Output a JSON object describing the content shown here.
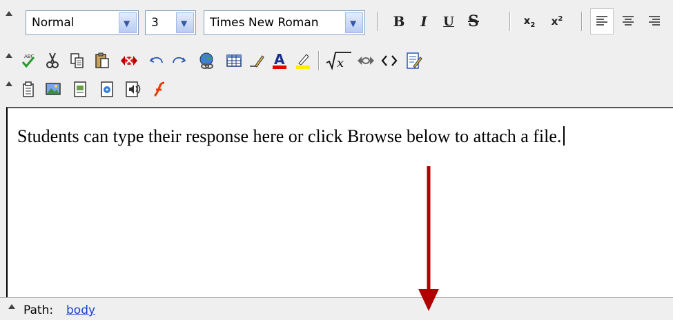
{
  "toolbar": {
    "format_select": {
      "value": "Normal"
    },
    "size_select": {
      "value": "3"
    },
    "font_select": {
      "value": "Times New Roman"
    },
    "bold_label": "B",
    "italic_label": "I",
    "underline_label": "U",
    "strikethrough_label": "S",
    "subscript_label": "x",
    "superscript_label": "x",
    "subscript_mark": "2",
    "superscript_mark": "2"
  },
  "colors": {
    "select_border": "#7f9db9",
    "text_color_bar": "#e00000",
    "highlight_bar": "#ffee00",
    "flash_icon": "#e63a00",
    "arrow": "#b00000",
    "link": "#1a3fd6"
  },
  "editor": {
    "content_text": "Students can type their response here or click Browse below to attach a file."
  },
  "statusbar": {
    "path_label": "Path:",
    "path_value": "body"
  }
}
